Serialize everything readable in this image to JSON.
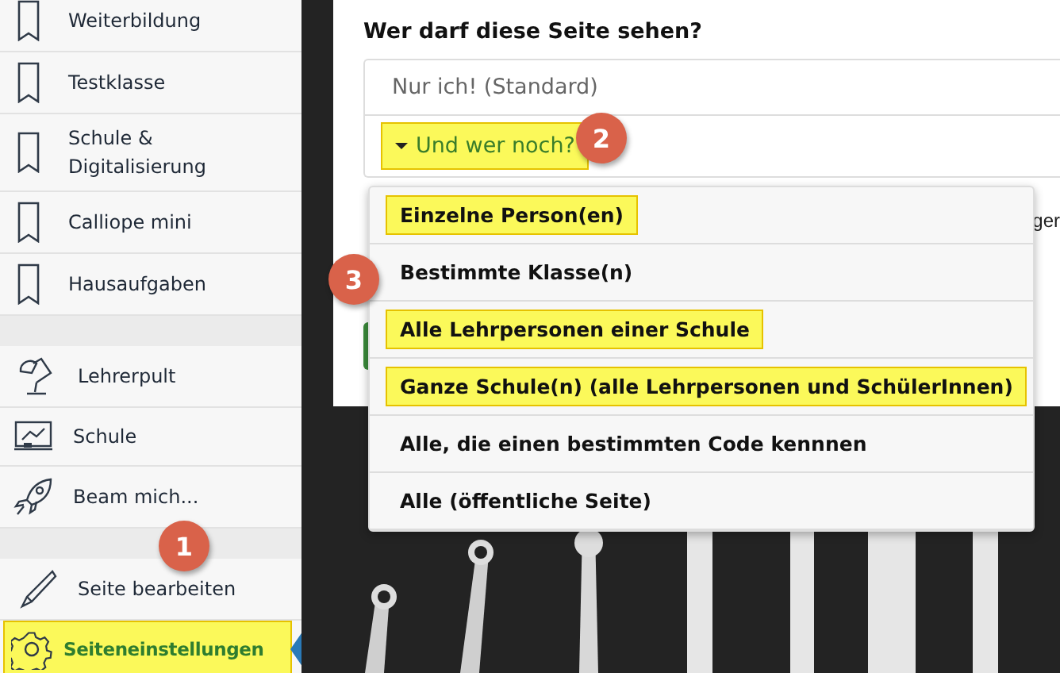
{
  "sidebar": {
    "groups": [
      {
        "items": [
          {
            "label": "Weiterbildung",
            "kind": "bookmark",
            "selected": false
          },
          {
            "label": "Testklasse",
            "kind": "bookmark",
            "selected": false
          },
          {
            "label": "Schule & Digitalisierung",
            "kind": "bookmark",
            "selected": false
          },
          {
            "label": "Calliope mini",
            "kind": "bookmark",
            "selected": false
          },
          {
            "label": "Hausaufgaben",
            "kind": "bookmark",
            "selected": false
          }
        ]
      },
      {
        "items": [
          {
            "label": "Lehrerpult",
            "kind": "lamp",
            "selected": false
          },
          {
            "label": "Schule",
            "kind": "board",
            "selected": false
          },
          {
            "label": "Beam mich...",
            "kind": "rocket",
            "selected": false
          }
        ]
      },
      {
        "items": [
          {
            "label": "Seite bearbeiten",
            "kind": "pencil",
            "selected": false
          },
          {
            "label": "Seiteneinstellungen",
            "kind": "gear",
            "selected": true
          }
        ]
      }
    ]
  },
  "visibility": {
    "heading": "Wer darf diese Seite sehen?",
    "default_option": "Nur ich! (Standard)",
    "more_button": "Und wer noch?",
    "hidden_text_end": "ger"
  },
  "dropdown": {
    "options": [
      {
        "label": "Einzelne Person(en)",
        "highlighted": true
      },
      {
        "label": "Bestimmte Klasse(n)",
        "highlighted": false
      },
      {
        "label": "Alle Lehrpersonen einer Schule",
        "highlighted": true
      },
      {
        "label": "Ganze Schule(n) (alle Lehrpersonen und SchülerInnen)",
        "highlighted": true
      },
      {
        "label": "Alle, die einen bestimmten Code kennnen",
        "highlighted": false
      },
      {
        "label": "Alle (öffentliche Seite)",
        "highlighted": false
      }
    ]
  },
  "markers": [
    {
      "label": "1"
    },
    {
      "label": "2"
    },
    {
      "label": "3"
    }
  ]
}
